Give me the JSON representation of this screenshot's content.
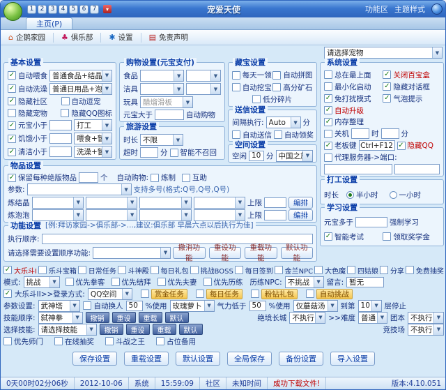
{
  "colors": {
    "titlebar": "#3a77cf",
    "accent_red": "#c00000",
    "label_blue": "#17327f",
    "group_title": "#0b3ea8"
  },
  "window": {
    "title": "宠爱天使",
    "index_buttons": [
      "1",
      "2",
      "3",
      "4",
      "5",
      "6",
      "7"
    ],
    "links": [
      "功能区",
      "主题样式"
    ]
  },
  "tabbar": {
    "home_tab": "主页(P)"
  },
  "toolbar": {
    "home": "企鹅家园",
    "club": "俱乐部",
    "settings": "设置",
    "disclaimer": "免责声明",
    "pet_select": "请选择宠物"
  },
  "basic": {
    "title": "基本设置",
    "feed_label": "自动喂食",
    "feed_checked": true,
    "feed_value": "普通食品+结晶",
    "bath_label": "自动洗澡",
    "bath_checked": true,
    "bath_value": "普通日用品+泡泡",
    "row3": [
      {
        "label": "隐藏社区",
        "checked": true
      },
      {
        "label": "自动逗宠",
        "checked": false
      }
    ],
    "row4": [
      {
        "label": "隐藏宠物",
        "checked": false
      },
      {
        "label": "隐藏QQ图标",
        "checked": false
      }
    ],
    "coin_label": "元宝小于",
    "coin_checked": true,
    "coin_value": "",
    "coin_action": "打工",
    "hunger_label": "饥饿小于",
    "hunger_checked": true,
    "hunger_value": "",
    "hunger_action": "喂食+暂停",
    "clean_label": "清洁小于",
    "clean_checked": true,
    "clean_value": "",
    "clean_action": "洗澡+暂停"
  },
  "shopping": {
    "title": "购物设置(元宝支付)",
    "food_label": "食品",
    "food_v1": "",
    "food_v2": "",
    "clean_label": "洁具",
    "clean_v1": "",
    "clean_v2": "",
    "toy_label": "玩具",
    "toy_value": "醋熘滑板",
    "coin_label": "元宝大于",
    "coin_value": "",
    "coin_suffix": "自动购物"
  },
  "travel": {
    "title": "旅游设置",
    "dur_label": "时长",
    "dur_value": "不限",
    "timeout_label": "超时",
    "timeout_value": "",
    "timeout_unit": "分",
    "recall_label": "智能不召回",
    "recall_checked": false
  },
  "treasure": {
    "title": "藏宝设置",
    "items": [
      {
        "label": "每天一领",
        "checked": false
      },
      {
        "label": "自动拼图",
        "checked": false
      },
      {
        "label": "自动挖宝",
        "checked": false
      },
      {
        "label": "高分矿石",
        "checked": false
      },
      {
        "label": "低分碎片",
        "checked": false
      }
    ]
  },
  "letter": {
    "title": "送信设置",
    "interval_label": "间隔执行:",
    "interval_value": "Auto",
    "interval_unit": "分",
    "items": [
      {
        "label": "自动送信",
        "checked": false
      },
      {
        "label": "自动领奖",
        "checked": false
      }
    ]
  },
  "space": {
    "title": "空间设置",
    "idle_label": "空闲",
    "idle_value": "10",
    "idle_unit": "分",
    "dest_value": "中国之旅"
  },
  "system": {
    "title": "系统设置",
    "row1": [
      {
        "label": "总在最上面",
        "checked": false
      },
      {
        "label": "关闭百宝盒",
        "checked": true,
        "color": "#c00000"
      }
    ],
    "row2": [
      {
        "label": "最小化启动",
        "checked": false
      },
      {
        "label": "隐藏对话框",
        "checked": true
      }
    ],
    "row3": [
      {
        "label": "免打扰模式",
        "checked": true
      },
      {
        "label": "气泡提示",
        "checked": true
      }
    ],
    "row4": [
      {
        "label": "自动升级",
        "checked": true,
        "color": "#c00000"
      }
    ],
    "row5": [
      {
        "label": "内存整理",
        "checked": true
      }
    ],
    "off_label": "关机",
    "off_checked": false,
    "off_h": "",
    "off_h_unit": "时",
    "off_m": "",
    "off_m_unit": "分",
    "boss_label": "老板键",
    "boss_checked": true,
    "boss_key": "Ctrl+F12",
    "hideqq_label": "隐藏QQ",
    "hideqq_checked": true,
    "proxy_label": "代理服务器->端口:",
    "proxy_checked": false,
    "proxy_host": "",
    "proxy_port": ""
  },
  "work": {
    "title": "打工设置",
    "dur_label": "时长",
    "options": [
      {
        "label": "半小时",
        "checked": true
      },
      {
        "label": "一小时",
        "checked": false
      }
    ]
  },
  "study": {
    "title": "学习设置",
    "coin_label": "元宝多于",
    "coin_value": "",
    "coin_suffix": "强制学习",
    "items": [
      {
        "label": "智能考试",
        "checked": true
      },
      {
        "label": "领取奖学金",
        "checked": false
      }
    ]
  },
  "goods": {
    "title": "物品设置",
    "keep_label": "保留每种绝版物品",
    "keep_checked": true,
    "keep_value": "",
    "keep_unit": "个",
    "autobuy_label": "自动购物:",
    "refine_label": "炼制",
    "refine_checked": false,
    "help_label": "互助",
    "help_checked": false,
    "param_label": "参数:",
    "param_value": "",
    "param_note": "支持多号(格式:Q号,Q号,Q号)",
    "crystal_label": "炼结晶",
    "crystal_values": [
      "",
      "",
      "",
      ""
    ],
    "crystal_limit_label": "上限",
    "crystal_limit": "",
    "arrange_label": "编排",
    "bubble_label": "炼泡泡",
    "bubble_values": [
      "",
      "",
      "",
      ""
    ],
    "bubble_limit_label": "上限",
    "bubble_limit": "",
    "arrange2_label": "编排"
  },
  "funcs": {
    "title": "功能设置",
    "hint": "[例:拜访家园->俱乐部->...,建议:俱乐部 早晨六点以后执行为佳]",
    "order_label": "执行顺序:",
    "pick_label": "请选择需要设置顺序功能:",
    "pick_value": "",
    "buttons": [
      "撤消功能",
      "重设功能",
      "重载功能",
      "默认功能"
    ]
  },
  "battle": {
    "rowA": [
      {
        "label": "大乐斗I",
        "checked": true,
        "color": "#c00000"
      },
      {
        "label": "乐斗宝箱",
        "checked": false
      },
      {
        "label": "日常任务",
        "checked": false
      },
      {
        "label": "斗神殿",
        "checked": false
      },
      {
        "label": "每日礼包",
        "checked": false
      },
      {
        "label": "挑战BOSS",
        "checked": false
      },
      {
        "label": "每日签到",
        "checked": false
      },
      {
        "label": "金兰NPC",
        "checked": false
      },
      {
        "label": "大色魔",
        "checked": false
      },
      {
        "label": "四姑娘",
        "checked": false
      },
      {
        "label": "分享",
        "checked": false
      },
      {
        "label": "免费抽奖",
        "checked": false
      }
    ],
    "mode_label": "模式:",
    "mode_value": "挑战",
    "rowB_cbs": [
      {
        "label": "优先拳客",
        "checked": false
      },
      {
        "label": "优先结拜",
        "checked": false
      },
      {
        "label": "优先夫妻",
        "checked": false
      },
      {
        "label": "优先历练",
        "checked": false
      }
    ],
    "npc_label": "历练NPC:",
    "npc_value": "不挑战",
    "msg_label": "留言:",
    "msg_value": "暂无",
    "dld2_label": "大乐斗II>>登录方式:",
    "dld2_checked": true,
    "login_value": "QQ空间",
    "gold_items": [
      {
        "label": "赏金任务",
        "checked": false
      },
      {
        "label": "每日任务",
        "checked": false
      },
      {
        "label": "粉钻礼包",
        "checked": false
      },
      {
        "label": "自动挑战",
        "checked": false
      }
    ],
    "param_label": "参数设置:",
    "tower_value": "武神塔",
    "swap_label": "自动换人",
    "swap_checked": false,
    "pct1": "50",
    "use1_label": "%使用",
    "item1_value": "玫瑰萝卜",
    "qi_label": "气力低于",
    "pct2": "50",
    "use2_label": "%使用",
    "item2_value": "仅蘑菇汤",
    "to_label": "到第",
    "floor_value": "10",
    "stop_label": "层停止",
    "skill_label": "技能顺序:",
    "skill_value": "弑神拳",
    "skill_btns": [
      "撤销",
      "重设",
      "重载",
      "默认"
    ],
    "wall_label": "绝境长城",
    "wall_value": "不执行",
    "diff_label": ">>难度",
    "diff_value": "普通",
    "raid_label": "团本",
    "raid_value": "不执行",
    "pick_label": "选择技能:",
    "pick_value": "请选择技能",
    "pick_btns": [
      "撤销",
      "重设",
      "重载",
      "默认"
    ],
    "arena_label": "竞技场",
    "arena_value": "不执行",
    "rowG": [
      {
        "label": "优先师门",
        "checked": false
      },
      {
        "label": "在线抽奖",
        "checked": false
      },
      {
        "label": "斗战之王",
        "checked": false
      },
      {
        "label": "占位备用",
        "checked": false
      }
    ]
  },
  "footer": {
    "buttons": [
      "保存设置",
      "重载设置",
      "默认设置",
      "全局保存",
      "备份设置",
      "导入设置"
    ]
  },
  "status": {
    "segments": [
      "0天00时02分06秒",
      "2012-10-06",
      "系统",
      "15:59:09",
      "社区",
      "未知时间"
    ],
    "alert": "成功下载文件!",
    "version": "版本:4.10.051"
  }
}
